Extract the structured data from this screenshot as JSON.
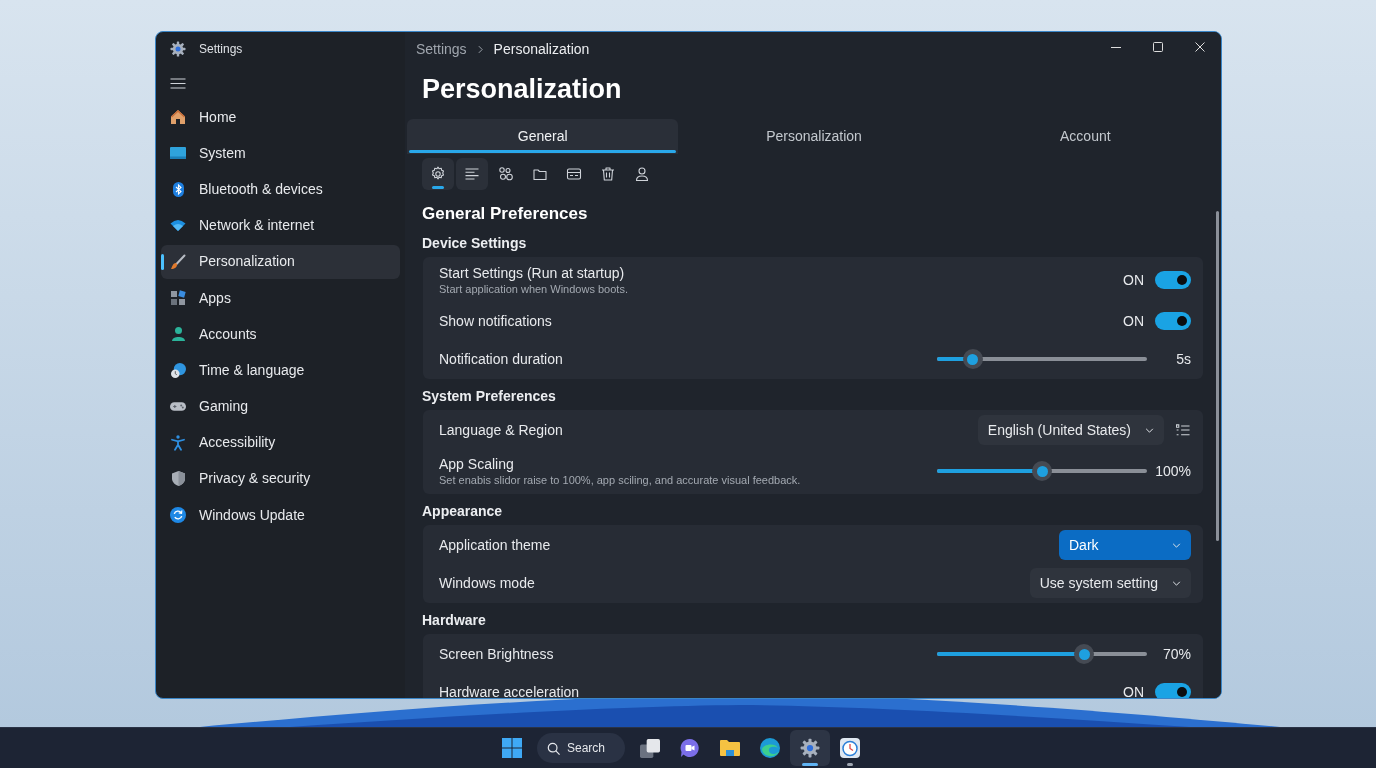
{
  "window": {
    "title": "Settings"
  },
  "sidebar": {
    "items": [
      {
        "label": "Home",
        "selected": false
      },
      {
        "label": "System",
        "selected": false
      },
      {
        "label": "Bluetooth & devices",
        "selected": false
      },
      {
        "label": "Network & internet",
        "selected": false
      },
      {
        "label": "Personalization",
        "selected": true
      },
      {
        "label": "Apps",
        "selected": false
      },
      {
        "label": "Accounts",
        "selected": false
      },
      {
        "label": "Time & language",
        "selected": false
      },
      {
        "label": "Gaming",
        "selected": false
      },
      {
        "label": "Accessibility",
        "selected": false
      },
      {
        "label": "Privacy & security",
        "selected": false
      },
      {
        "label": "Windows Update",
        "selected": false
      }
    ]
  },
  "breadcrumb": [
    "Settings",
    "Personalization"
  ],
  "page_title": "Personalization",
  "tabs": [
    {
      "label": "General",
      "selected": true
    },
    {
      "label": "Personalization",
      "selected": false
    },
    {
      "label": "Account",
      "selected": false
    }
  ],
  "toolbar": [
    {
      "selected": true
    },
    {
      "selected": false,
      "hovered": true
    },
    {
      "selected": false
    },
    {
      "selected": false
    },
    {
      "selected": false
    },
    {
      "selected": false
    },
    {
      "selected": false
    }
  ],
  "content": {
    "title": "General Preferences",
    "sections": [
      {
        "heading": "Device Settings",
        "rows": [
          {
            "kind": "toggle",
            "label": "Start Settings (Run at startup)",
            "description": "Start application when Windows boots.",
            "state_text": "ON",
            "on": true
          },
          {
            "kind": "toggle",
            "label": "Show notifications",
            "state_text": "ON",
            "on": true
          },
          {
            "kind": "slider",
            "label": "Notification duration",
            "level": 0.17,
            "reading": "5s"
          }
        ]
      },
      {
        "heading": "System Preferences",
        "rows": [
          {
            "kind": "dropdown",
            "label": "Language & Region",
            "value": "English (United States)",
            "accent": false,
            "options_button": true
          },
          {
            "kind": "slider",
            "label": "App Scaling",
            "description": "Set enabis slidor raise to 100%, app sciling, and accurate visual feedback.",
            "level": 0.5,
            "reading": "100%"
          }
        ]
      },
      {
        "heading": "Appearance",
        "rows": [
          {
            "kind": "dropdown",
            "label": "Application theme",
            "value": "Dark",
            "accent": true
          },
          {
            "kind": "dropdown",
            "label": "Windows mode",
            "value": "Use system setting",
            "accent": false
          }
        ]
      },
      {
        "heading": "Hardware",
        "rows": [
          {
            "kind": "slider",
            "label": "Screen Brightness",
            "level": 0.7,
            "reading": "70%"
          },
          {
            "kind": "toggle",
            "label": "Hardware acceleration",
            "state_text": "ON",
            "on": true
          }
        ]
      }
    ]
  },
  "taskbar": {
    "search": {
      "placeholder": "Search"
    },
    "apps": [
      {
        "selected": false
      },
      {
        "selected": false
      },
      {
        "selected": false
      },
      {
        "selected": false
      },
      {
        "selected": true
      },
      {
        "selected": false,
        "running": true
      }
    ]
  }
}
